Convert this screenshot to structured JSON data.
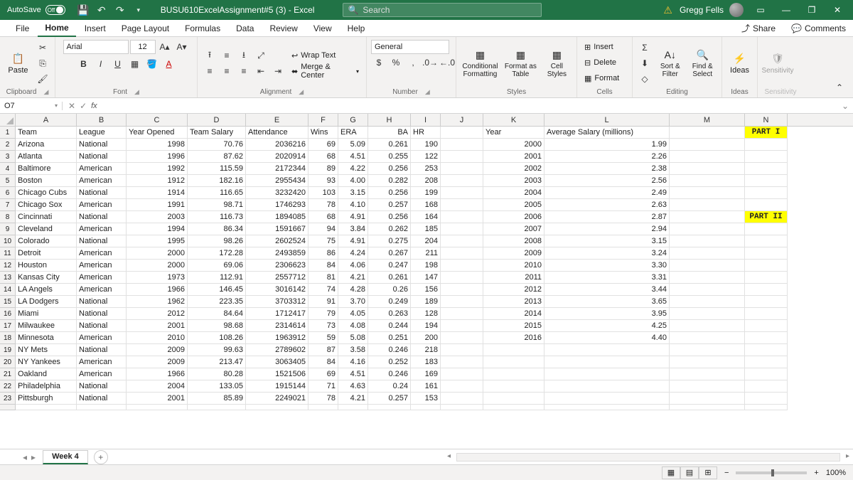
{
  "title_bar": {
    "autosave": "AutoSave",
    "autosave_state": "Off",
    "filename": "BUSU610ExcelAssignment#5 (3) - Excel",
    "search_placeholder": "Search",
    "user_name": "Gregg Fells"
  },
  "menu": {
    "file": "File",
    "home": "Home",
    "insert": "Insert",
    "page_layout": "Page Layout",
    "formulas": "Formulas",
    "data": "Data",
    "review": "Review",
    "view": "View",
    "help": "Help",
    "share": "Share",
    "comments": "Comments"
  },
  "ribbon": {
    "clipboard": {
      "label": "Clipboard",
      "paste": "Paste"
    },
    "font": {
      "label": "Font",
      "name": "Arial",
      "size": "12"
    },
    "alignment": {
      "label": "Alignment",
      "wrap": "Wrap Text",
      "merge": "Merge & Center"
    },
    "number": {
      "label": "Number",
      "format": "General"
    },
    "styles": {
      "label": "Styles",
      "cond": "Conditional Formatting",
      "table": "Format as Table",
      "cell": "Cell Styles"
    },
    "cells": {
      "label": "Cells",
      "insert": "Insert",
      "delete": "Delete",
      "format": "Format"
    },
    "editing": {
      "label": "Editing",
      "sort": "Sort & Filter",
      "find": "Find & Select"
    },
    "ideas": {
      "label": "Ideas",
      "ideas": "Ideas"
    },
    "sens": {
      "label": "Sensitivity",
      "sens": "Sensitivity"
    }
  },
  "name_box": "O7",
  "columns": [
    "A",
    "B",
    "C",
    "D",
    "E",
    "F",
    "G",
    "H",
    "I",
    "J",
    "K",
    "L",
    "M",
    "N"
  ],
  "header_row": {
    "A": "Team",
    "B": "League",
    "C": "Year Opened",
    "D": "Team Salary",
    "E": "Attendance",
    "F": "Wins",
    "G": "ERA",
    "H": "BA",
    "I": "HR",
    "J": "",
    "K": "Year",
    "L": "Average Salary (millions)",
    "M": "",
    "N": "PART I"
  },
  "part2_label": "PART II",
  "data_rows": [
    [
      "Arizona",
      "National",
      "1998",
      "70.76",
      "2036216",
      "69",
      "5.09",
      "0.261",
      "190",
      "",
      "2000",
      "1.99"
    ],
    [
      "Atlanta",
      "National",
      "1996",
      "87.62",
      "2020914",
      "68",
      "4.51",
      "0.255",
      "122",
      "",
      "2001",
      "2.26"
    ],
    [
      "Baltimore",
      "American",
      "1992",
      "115.59",
      "2172344",
      "89",
      "4.22",
      "0.256",
      "253",
      "",
      "2002",
      "2.38"
    ],
    [
      "Boston",
      "American",
      "1912",
      "182.16",
      "2955434",
      "93",
      "4.00",
      "0.282",
      "208",
      "",
      "2003",
      "2.56"
    ],
    [
      "Chicago Cubs",
      "National",
      "1914",
      "116.65",
      "3232420",
      "103",
      "3.15",
      "0.256",
      "199",
      "",
      "2004",
      "2.49"
    ],
    [
      "Chicago Sox",
      "American",
      "1991",
      "98.71",
      "1746293",
      "78",
      "4.10",
      "0.257",
      "168",
      "",
      "2005",
      "2.63"
    ],
    [
      "Cincinnati",
      "National",
      "2003",
      "116.73",
      "1894085",
      "68",
      "4.91",
      "0.256",
      "164",
      "",
      "2006",
      "2.87"
    ],
    [
      "Cleveland",
      "American",
      "1994",
      "86.34",
      "1591667",
      "94",
      "3.84",
      "0.262",
      "185",
      "",
      "2007",
      "2.94"
    ],
    [
      "Colorado",
      "National",
      "1995",
      "98.26",
      "2602524",
      "75",
      "4.91",
      "0.275",
      "204",
      "",
      "2008",
      "3.15"
    ],
    [
      "Detroit",
      "American",
      "2000",
      "172.28",
      "2493859",
      "86",
      "4.24",
      "0.267",
      "211",
      "",
      "2009",
      "3.24"
    ],
    [
      "Houston",
      "American",
      "2000",
      "69.06",
      "2306623",
      "84",
      "4.06",
      "0.247",
      "198",
      "",
      "2010",
      "3.30"
    ],
    [
      "Kansas City",
      "American",
      "1973",
      "112.91",
      "2557712",
      "81",
      "4.21",
      "0.261",
      "147",
      "",
      "2011",
      "3.31"
    ],
    [
      "LA Angels",
      "American",
      "1966",
      "146.45",
      "3016142",
      "74",
      "4.28",
      "0.26",
      "156",
      "",
      "2012",
      "3.44"
    ],
    [
      "LA Dodgers",
      "National",
      "1962",
      "223.35",
      "3703312",
      "91",
      "3.70",
      "0.249",
      "189",
      "",
      "2013",
      "3.65"
    ],
    [
      "Miami",
      "National",
      "2012",
      "84.64",
      "1712417",
      "79",
      "4.05",
      "0.263",
      "128",
      "",
      "2014",
      "3.95"
    ],
    [
      "Milwaukee",
      "National",
      "2001",
      "98.68",
      "2314614",
      "73",
      "4.08",
      "0.244",
      "194",
      "",
      "2015",
      "4.25"
    ],
    [
      "Minnesota",
      "American",
      "2010",
      "108.26",
      "1963912",
      "59",
      "5.08",
      "0.251",
      "200",
      "",
      "2016",
      "4.40"
    ],
    [
      "NY Mets",
      "National",
      "2009",
      "99.63",
      "2789602",
      "87",
      "3.58",
      "0.246",
      "218",
      "",
      "",
      ""
    ],
    [
      "NY Yankees",
      "American",
      "2009",
      "213.47",
      "3063405",
      "84",
      "4.16",
      "0.252",
      "183",
      "",
      "",
      ""
    ],
    [
      "Oakland",
      "American",
      "1966",
      "80.28",
      "1521506",
      "69",
      "4.51",
      "0.246",
      "169",
      "",
      "",
      ""
    ],
    [
      "Philadelphia",
      "National",
      "2004",
      "133.05",
      "1915144",
      "71",
      "4.63",
      "0.24",
      "161",
      "",
      "",
      ""
    ],
    [
      "Pittsburgh",
      "National",
      "2001",
      "85.89",
      "2249021",
      "78",
      "4.21",
      "0.257",
      "153",
      "",
      "",
      ""
    ]
  ],
  "sheet_tab": "Week 4",
  "zoom": "100%"
}
